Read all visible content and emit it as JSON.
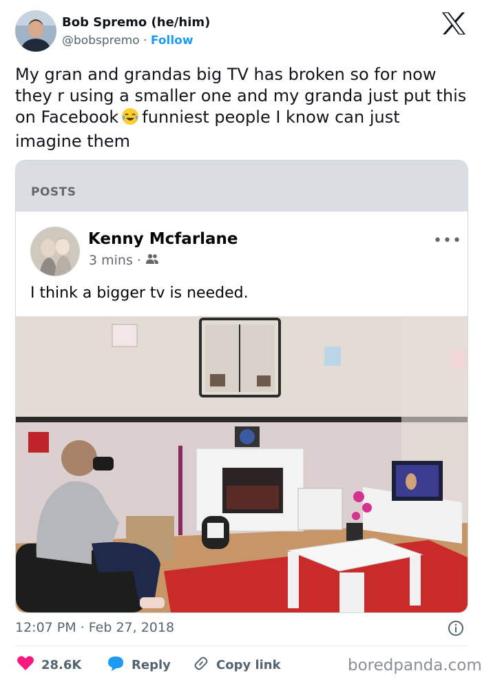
{
  "author": {
    "name": "Bob Spremo (he/him)",
    "handle": "@bobspremo",
    "separator": "·",
    "follow_label": "Follow"
  },
  "tweet": {
    "text_before_emoji": "My gran and grandas big TV has broken so for now they r using a smaller one and my granda just put this on Facebook",
    "emoji": "face-with-tears-of-joy",
    "text_after_emoji": "funniest people I know can just imagine them"
  },
  "embedded_post": {
    "section_label": "POSTS",
    "author_name": "Kenny Mcfarlane",
    "time": "3 mins",
    "meta_separator": "·",
    "audience_icon": "friends-icon",
    "more_label": "•••",
    "text": "I think a bigger tv is needed."
  },
  "footer": {
    "timestamp": "12:07 PM · Feb 27, 2018",
    "likes": "28.6K",
    "reply_label": "Reply",
    "copy_link_label": "Copy link",
    "watermark": "boredpanda.com"
  },
  "colors": {
    "accent": "#1d9bf0",
    "like": "#f91880",
    "muted": "#536471"
  }
}
